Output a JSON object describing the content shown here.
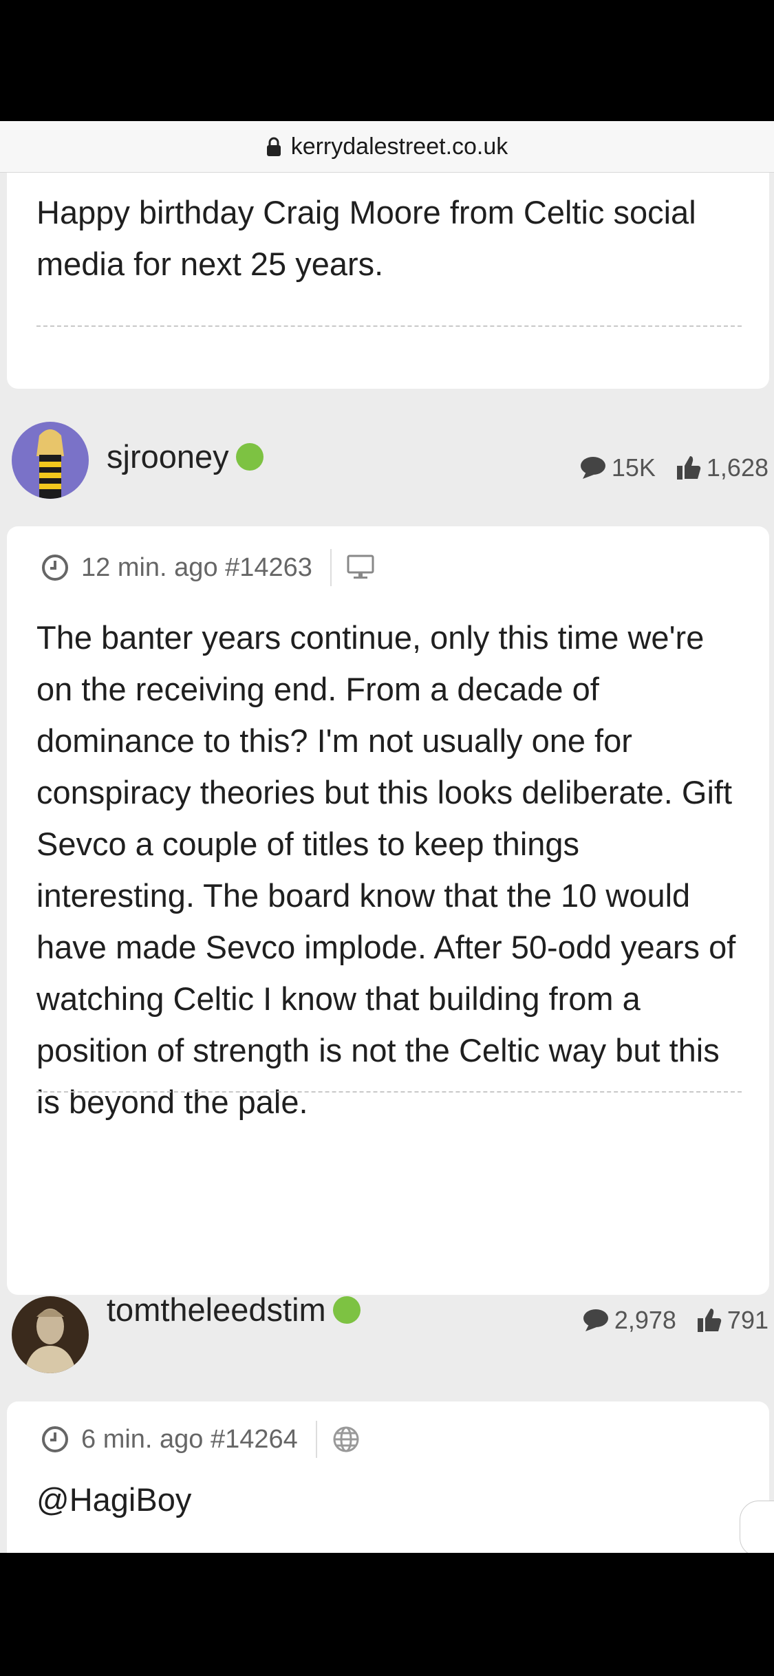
{
  "browser": {
    "url": "kerrydalestreet.co.uk"
  },
  "posts": [
    {
      "body": "Happy birthday Craig Moore from Celtic social media for next 25 years."
    },
    {
      "user": {
        "name": "sjrooney",
        "posts_count": "15K",
        "likes_count": "1,628"
      },
      "time": "12 min. ago",
      "post_id": "#14263",
      "device": "desktop-icon",
      "body": "The banter years continue, only this time we're on the receiving end. From a decade of dominance to this? I'm not usually one for conspiracy theories but this looks deliberate. Gift Sevco a couple of titles to keep things interesting. The board know that the 10 would have made Sevco implode. After 50-odd years of watching Celtic I know that building from a position of strength is not the Celtic way but this is beyond the pale."
    },
    {
      "user": {
        "name": "tomtheleedstim",
        "posts_count": "2,978",
        "likes_count": "791"
      },
      "time": "6 min. ago",
      "post_id": "#14264",
      "device": "globe-icon",
      "body": "@HagiBoy"
    }
  ],
  "colors": {
    "online": "#7dc242",
    "page_bg": "#ececec",
    "card_bg": "#ffffff"
  }
}
